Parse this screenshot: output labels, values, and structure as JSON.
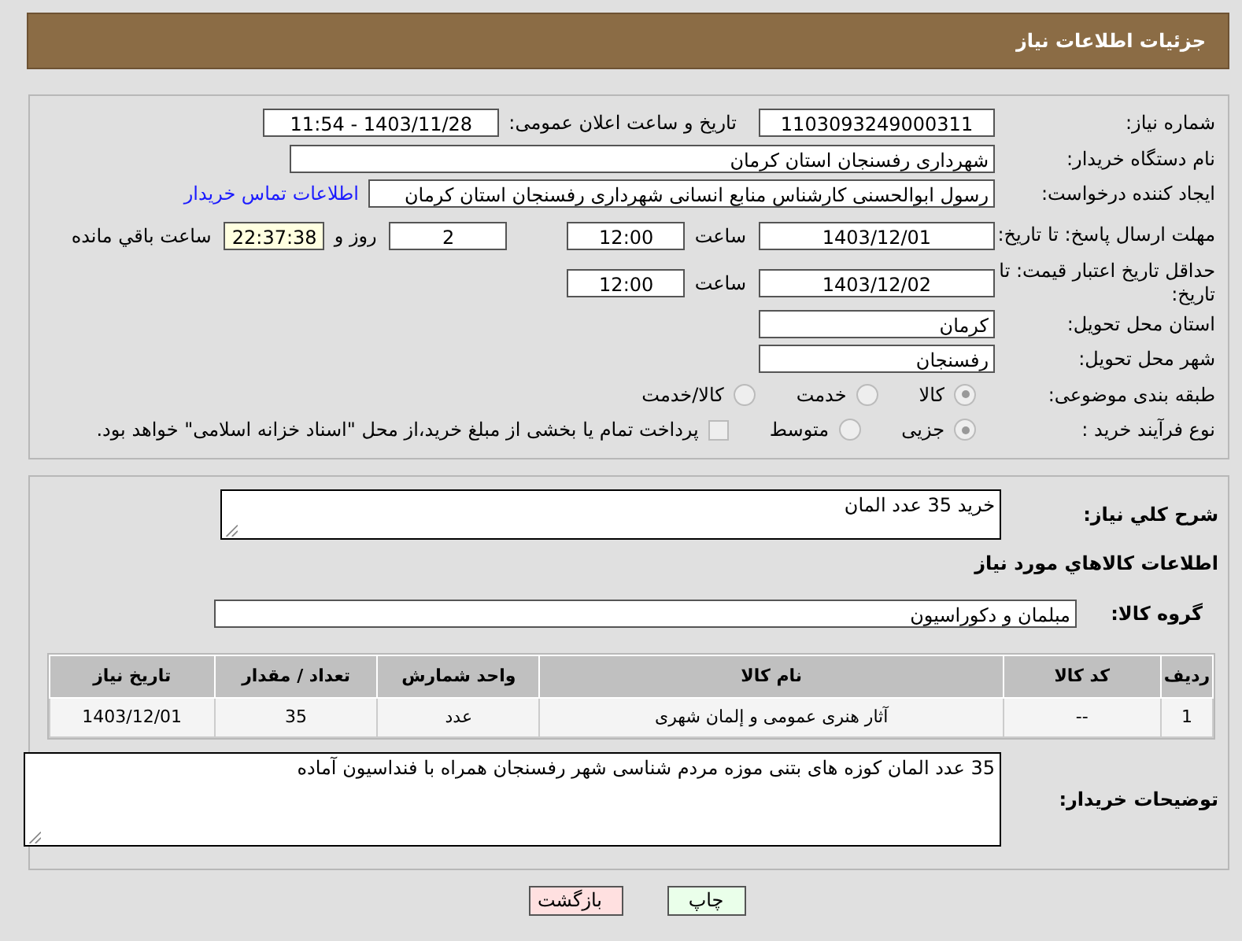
{
  "header": {
    "title": "جزئیات اطلاعات نیاز"
  },
  "need_number": {
    "label": "شماره نیاز:",
    "value": "1103093249000311"
  },
  "announce": {
    "label": "تاریخ و ساعت اعلان عمومی:",
    "value": "1403/11/28 - 11:54"
  },
  "buyer_org": {
    "label": "نام دستگاه خریدار:",
    "value": "شهرداری رفسنجان استان کرمان"
  },
  "requester": {
    "label": "ایجاد کننده درخواست:",
    "value": "رسول ابوالحسنی کارشناس منابع انسانی شهرداری رفسنجان استان کرمان",
    "link": "اطلاعات تماس خریدار"
  },
  "reply_deadline": {
    "label": "مهلت ارسال پاسخ: تا تاریخ:",
    "date": "1403/12/01",
    "time_label": "ساعت",
    "time": "12:00",
    "days": "2",
    "days_label": "روز و",
    "remaining": "22:37:38",
    "remaining_label": "ساعت باقي مانده"
  },
  "price_validity": {
    "label": "حداقل تاریخ اعتبار قیمت: تا تاریخ:",
    "date": "1403/12/02",
    "time_label": "ساعت",
    "time": "12:00"
  },
  "province": {
    "label": "استان محل تحویل:",
    "value": "کرمان"
  },
  "city": {
    "label": "شهر محل تحویل:",
    "value": "رفسنجان"
  },
  "category": {
    "label": "طبقه بندی موضوعی:",
    "options": [
      {
        "label": "کالا",
        "selected": true
      },
      {
        "label": "خدمت",
        "selected": false
      },
      {
        "label": "کالا/خدمت",
        "selected": false
      }
    ]
  },
  "process": {
    "label": "نوع فرآیند خرید :",
    "options": [
      {
        "label": "جزیی",
        "selected": true
      },
      {
        "label": "متوسط",
        "selected": false
      }
    ],
    "treasury": {
      "label": "پرداخت تمام یا بخشی از مبلغ خرید،از محل \"اسناد خزانه اسلامی\" خواهد بود.",
      "checked": false
    }
  },
  "description": {
    "label": "شرح کلي نیاز:",
    "value": "خرید 35 عدد المان"
  },
  "goods_title": "اطلاعات کالاهاي مورد نیاز",
  "goods_group": {
    "label": "گروه کالا:",
    "value": "مبلمان و دکوراسیون"
  },
  "table": {
    "columns": [
      "ردیف",
      "کد کالا",
      "نام کالا",
      "واحد شمارش",
      "تعداد / مقدار",
      "تاریخ نیاز"
    ],
    "rows": [
      [
        "1",
        "--",
        "آثار هنری عمومی و إلمان شهری",
        "عدد",
        "35",
        "1403/12/01"
      ]
    ]
  },
  "buyer_notes": {
    "label": "توضیحات خریدار:",
    "value": "35 عدد المان کوزه های بتنی موزه مردم شناسی شهر رفسنجان همراه با فنداسیون آماده"
  },
  "buttons": [
    {
      "label": "چاپ",
      "kind": "print"
    },
    {
      "label": "بازگشت",
      "kind": "back"
    }
  ]
}
